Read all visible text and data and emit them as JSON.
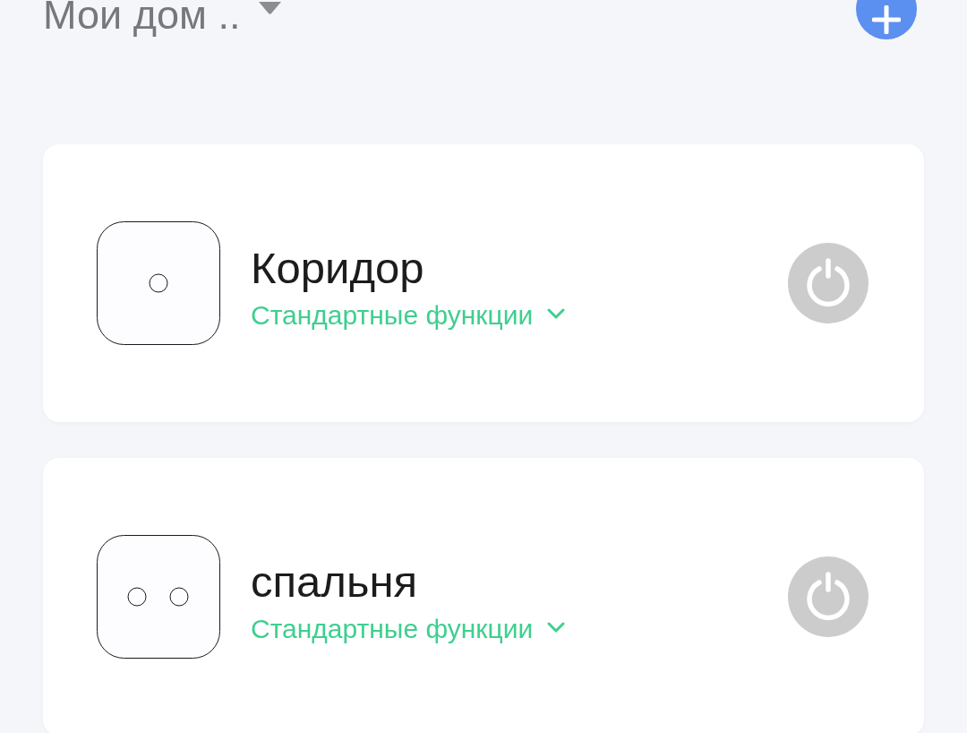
{
  "header": {
    "home_selector": "Мои дом .."
  },
  "devices": [
    {
      "name": "Коридор",
      "kind": "single",
      "functions": "Стандартные функции",
      "on": false
    },
    {
      "name": "спальня",
      "kind": "double",
      "functions": "Стандартные функции",
      "on": false
    }
  ]
}
